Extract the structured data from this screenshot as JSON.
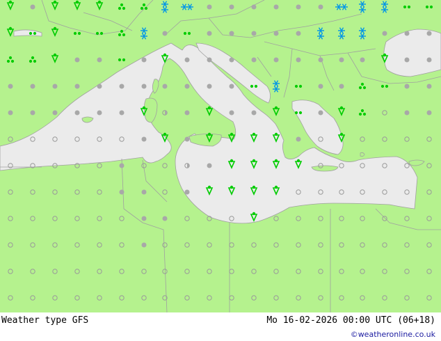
{
  "footer": {
    "title": "Weather type   GFS",
    "datetime": "Mo 16-02-2026 00:00 UTC (06+18)",
    "credit": "©weatheronline.co.uk"
  },
  "colors": {
    "land": "#b5f28e",
    "sea": "#ebebeb",
    "border": "#a0a0a0",
    "rain": "#00cc00",
    "snow": "#0095e8",
    "cloud_filled": "#a8a8a8",
    "cloud_open": "#9a9a9a"
  },
  "legend_icons": [
    "shower-icon",
    "drizzle-icon",
    "snow-icon",
    "cloud-icon",
    "partly-cloudy-icon",
    "clear-icon"
  ],
  "symbols": [
    [
      15,
      10,
      "shower"
    ],
    [
      47,
      10,
      "filled"
    ],
    [
      79,
      10,
      "shower"
    ],
    [
      111,
      10,
      "shower"
    ],
    [
      143,
      10,
      "shower"
    ],
    [
      175,
      10,
      "clover"
    ],
    [
      207,
      10,
      "clover"
    ],
    [
      237,
      10,
      "snowshower"
    ],
    [
      269,
      10,
      "snowpair"
    ],
    [
      301,
      10,
      "filled"
    ],
    [
      333,
      10,
      "filled"
    ],
    [
      365,
      10,
      "filled"
    ],
    [
      397,
      10,
      "filled"
    ],
    [
      429,
      10,
      "filled"
    ],
    [
      461,
      10,
      "filled"
    ],
    [
      491,
      10,
      "snowpair"
    ],
    [
      521,
      10,
      "snowshower"
    ],
    [
      553,
      10,
      "snowshower"
    ],
    [
      585,
      10,
      "drizzle"
    ],
    [
      617,
      10,
      "drizzle"
    ],
    [
      15,
      48,
      "shower"
    ],
    [
      47,
      48,
      "drizzle"
    ],
    [
      79,
      48,
      "shower"
    ],
    [
      111,
      48,
      "drizzle"
    ],
    [
      143,
      48,
      "drizzle"
    ],
    [
      175,
      48,
      "clover"
    ],
    [
      207,
      48,
      "snowshower"
    ],
    [
      237,
      48,
      "filled"
    ],
    [
      269,
      48,
      "drizzle"
    ],
    [
      301,
      48,
      "filled"
    ],
    [
      333,
      48,
      "filled"
    ],
    [
      365,
      48,
      "filled"
    ],
    [
      397,
      48,
      "filled"
    ],
    [
      429,
      48,
      "filled"
    ],
    [
      461,
      48,
      "snowshower"
    ],
    [
      491,
      48,
      "snowshower"
    ],
    [
      521,
      48,
      "snowshower"
    ],
    [
      553,
      48,
      "filled"
    ],
    [
      585,
      48,
      "filled"
    ],
    [
      617,
      48,
      "filled"
    ],
    [
      15,
      86,
      "clover"
    ],
    [
      47,
      86,
      "clover"
    ],
    [
      79,
      86,
      "shower"
    ],
    [
      111,
      86,
      "filled"
    ],
    [
      143,
      86,
      "filled"
    ],
    [
      175,
      86,
      "drizzle"
    ],
    [
      207,
      86,
      "filled"
    ],
    [
      237,
      86,
      "shower"
    ],
    [
      269,
      86,
      "filled"
    ],
    [
      301,
      86,
      "filled"
    ],
    [
      333,
      86,
      "filled"
    ],
    [
      365,
      86,
      "filled"
    ],
    [
      397,
      86,
      "filled"
    ],
    [
      429,
      86,
      "filled"
    ],
    [
      461,
      86,
      "filled"
    ],
    [
      491,
      86,
      "filled"
    ],
    [
      521,
      86,
      "filled"
    ],
    [
      553,
      86,
      "shower"
    ],
    [
      585,
      86,
      "filled"
    ],
    [
      617,
      86,
      "filled"
    ],
    [
      15,
      124,
      "filled"
    ],
    [
      47,
      124,
      "filled"
    ],
    [
      79,
      124,
      "filled"
    ],
    [
      111,
      124,
      "filled"
    ],
    [
      143,
      124,
      "filled"
    ],
    [
      175,
      124,
      "filled"
    ],
    [
      207,
      124,
      "filled"
    ],
    [
      237,
      124,
      "filled"
    ],
    [
      269,
      124,
      "filled"
    ],
    [
      301,
      124,
      "filled"
    ],
    [
      333,
      124,
      "filled"
    ],
    [
      365,
      124,
      "drizzle"
    ],
    [
      397,
      124,
      "snowshower"
    ],
    [
      429,
      124,
      "drizzle"
    ],
    [
      461,
      124,
      "filled"
    ],
    [
      491,
      124,
      "filled"
    ],
    [
      521,
      124,
      "clover"
    ],
    [
      553,
      124,
      "drizzle"
    ],
    [
      585,
      124,
      "filled"
    ],
    [
      617,
      124,
      "filled"
    ],
    [
      15,
      162,
      "filled"
    ],
    [
      47,
      162,
      "filled"
    ],
    [
      79,
      162,
      "filled"
    ],
    [
      111,
      162,
      "filled"
    ],
    [
      143,
      162,
      "filled"
    ],
    [
      175,
      162,
      "filled"
    ],
    [
      207,
      162,
      "shower"
    ],
    [
      237,
      162,
      "half"
    ],
    [
      269,
      162,
      "filled"
    ],
    [
      301,
      162,
      "shower"
    ],
    [
      333,
      162,
      "filled"
    ],
    [
      365,
      162,
      "filled"
    ],
    [
      397,
      162,
      "shower"
    ],
    [
      429,
      162,
      "drizzle"
    ],
    [
      461,
      162,
      "filled"
    ],
    [
      491,
      162,
      "shower"
    ],
    [
      521,
      162,
      "clover"
    ],
    [
      553,
      162,
      "open"
    ],
    [
      585,
      162,
      "filled"
    ],
    [
      617,
      162,
      "filled"
    ],
    [
      15,
      200,
      "open"
    ],
    [
      47,
      200,
      "open"
    ],
    [
      79,
      200,
      "open"
    ],
    [
      111,
      200,
      "open"
    ],
    [
      143,
      200,
      "open"
    ],
    [
      175,
      200,
      "open"
    ],
    [
      207,
      200,
      "filled"
    ],
    [
      237,
      200,
      "shower"
    ],
    [
      269,
      200,
      "filled"
    ],
    [
      301,
      200,
      "shower"
    ],
    [
      333,
      200,
      "shower"
    ],
    [
      365,
      200,
      "shower"
    ],
    [
      397,
      200,
      "shower"
    ],
    [
      429,
      200,
      "filled"
    ],
    [
      461,
      200,
      "open"
    ],
    [
      491,
      200,
      "shower"
    ],
    [
      521,
      200,
      "open"
    ],
    [
      553,
      200,
      "open"
    ],
    [
      585,
      200,
      "open"
    ],
    [
      617,
      200,
      "open"
    ],
    [
      15,
      238,
      "open"
    ],
    [
      47,
      238,
      "open"
    ],
    [
      79,
      238,
      "open"
    ],
    [
      111,
      238,
      "open"
    ],
    [
      143,
      238,
      "open"
    ],
    [
      175,
      238,
      "filled"
    ],
    [
      207,
      238,
      "open"
    ],
    [
      237,
      238,
      "open"
    ],
    [
      269,
      238,
      "half"
    ],
    [
      301,
      238,
      "filled"
    ],
    [
      333,
      238,
      "shower"
    ],
    [
      365,
      238,
      "shower"
    ],
    [
      397,
      238,
      "shower"
    ],
    [
      429,
      238,
      "shower"
    ],
    [
      461,
      238,
      "open"
    ],
    [
      491,
      238,
      "open"
    ],
    [
      521,
      238,
      "open"
    ],
    [
      553,
      238,
      "open"
    ],
    [
      585,
      238,
      "open"
    ],
    [
      617,
      238,
      "open"
    ],
    [
      15,
      276,
      "open"
    ],
    [
      47,
      276,
      "open"
    ],
    [
      79,
      276,
      "open"
    ],
    [
      111,
      276,
      "open"
    ],
    [
      143,
      276,
      "open"
    ],
    [
      175,
      276,
      "filled"
    ],
    [
      207,
      276,
      "filled"
    ],
    [
      237,
      276,
      "open"
    ],
    [
      269,
      276,
      "filled"
    ],
    [
      301,
      276,
      "shower"
    ],
    [
      333,
      276,
      "shower"
    ],
    [
      365,
      276,
      "shower"
    ],
    [
      397,
      276,
      "shower"
    ],
    [
      429,
      276,
      "open"
    ],
    [
      461,
      276,
      "open"
    ],
    [
      491,
      276,
      "open"
    ],
    [
      521,
      276,
      "open"
    ],
    [
      553,
      276,
      "open"
    ],
    [
      585,
      276,
      "open"
    ],
    [
      617,
      276,
      "open"
    ],
    [
      15,
      314,
      "open"
    ],
    [
      47,
      314,
      "open"
    ],
    [
      79,
      314,
      "open"
    ],
    [
      111,
      314,
      "open"
    ],
    [
      143,
      314,
      "open"
    ],
    [
      175,
      314,
      "open"
    ],
    [
      207,
      314,
      "filled"
    ],
    [
      237,
      314,
      "filled"
    ],
    [
      269,
      314,
      "open"
    ],
    [
      301,
      314,
      "open"
    ],
    [
      333,
      314,
      "open"
    ],
    [
      365,
      314,
      "shower"
    ],
    [
      397,
      314,
      "open"
    ],
    [
      429,
      314,
      "open"
    ],
    [
      461,
      314,
      "open"
    ],
    [
      491,
      314,
      "open"
    ],
    [
      521,
      314,
      "open"
    ],
    [
      553,
      314,
      "open"
    ],
    [
      585,
      314,
      "open"
    ],
    [
      617,
      314,
      "open"
    ],
    [
      15,
      352,
      "open"
    ],
    [
      47,
      352,
      "open"
    ],
    [
      79,
      352,
      "open"
    ],
    [
      111,
      352,
      "open"
    ],
    [
      143,
      352,
      "open"
    ],
    [
      175,
      352,
      "open"
    ],
    [
      207,
      352,
      "filled"
    ],
    [
      237,
      352,
      "open"
    ],
    [
      269,
      352,
      "open"
    ],
    [
      301,
      352,
      "open"
    ],
    [
      333,
      352,
      "open"
    ],
    [
      365,
      352,
      "open"
    ],
    [
      397,
      352,
      "open"
    ],
    [
      429,
      352,
      "open"
    ],
    [
      461,
      352,
      "open"
    ],
    [
      491,
      352,
      "open"
    ],
    [
      521,
      352,
      "open"
    ],
    [
      553,
      352,
      "open"
    ],
    [
      585,
      352,
      "open"
    ],
    [
      617,
      352,
      "open"
    ],
    [
      15,
      390,
      "open"
    ],
    [
      47,
      390,
      "open"
    ],
    [
      79,
      390,
      "open"
    ],
    [
      111,
      390,
      "open"
    ],
    [
      143,
      390,
      "open"
    ],
    [
      175,
      390,
      "open"
    ],
    [
      207,
      390,
      "open"
    ],
    [
      237,
      390,
      "open"
    ],
    [
      269,
      390,
      "open"
    ],
    [
      301,
      390,
      "open"
    ],
    [
      333,
      390,
      "open"
    ],
    [
      365,
      390,
      "open"
    ],
    [
      397,
      390,
      "open"
    ],
    [
      429,
      390,
      "open"
    ],
    [
      461,
      390,
      "open"
    ],
    [
      491,
      390,
      "open"
    ],
    [
      521,
      390,
      "open"
    ],
    [
      553,
      390,
      "open"
    ],
    [
      585,
      390,
      "open"
    ],
    [
      617,
      390,
      "open"
    ],
    [
      15,
      428,
      "open"
    ],
    [
      47,
      428,
      "open"
    ],
    [
      79,
      428,
      "open"
    ],
    [
      111,
      428,
      "open"
    ],
    [
      143,
      428,
      "open"
    ],
    [
      175,
      428,
      "open"
    ],
    [
      207,
      428,
      "open"
    ],
    [
      237,
      428,
      "open"
    ],
    [
      269,
      428,
      "open"
    ],
    [
      301,
      428,
      "open"
    ],
    [
      333,
      428,
      "open"
    ],
    [
      365,
      428,
      "open"
    ],
    [
      397,
      428,
      "open"
    ],
    [
      429,
      428,
      "open"
    ],
    [
      461,
      428,
      "open"
    ],
    [
      491,
      428,
      "open"
    ],
    [
      521,
      428,
      "open"
    ],
    [
      553,
      428,
      "open"
    ],
    [
      585,
      428,
      "open"
    ],
    [
      617,
      428,
      "open"
    ]
  ]
}
